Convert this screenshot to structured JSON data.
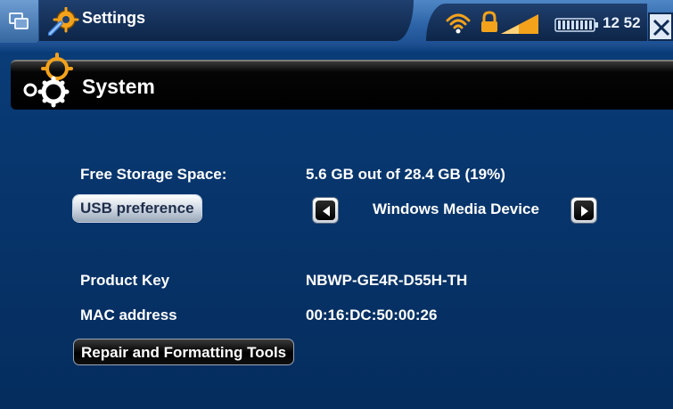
{
  "topbar": {
    "app_title": "Settings",
    "clock": "12 52",
    "icons": [
      "multitask-icon",
      "settings-gear-icon",
      "wifi-icon",
      "lock-icon",
      "signal-strength-icon",
      "battery-icon",
      "close-icon"
    ]
  },
  "section": {
    "title": "System",
    "icon": "gears-icon"
  },
  "settings": {
    "free_storage_label": "Free Storage Space:",
    "free_storage_value": "5.6 GB out of 28.4 GB (19%)",
    "usb_button_label": "USB preference",
    "usb_value": "Windows Media Device",
    "product_key_label": "Product Key",
    "product_key_value": "NBWP-GE4R-D55H-TH",
    "mac_label": "MAC address",
    "mac_value": "00:16:DC:50:00:26",
    "repair_button_label": "Repair and Formatting Tools"
  },
  "colors": {
    "background": "#07346b",
    "header_bar": "#000000",
    "accent_orange": "#f3a21b"
  }
}
